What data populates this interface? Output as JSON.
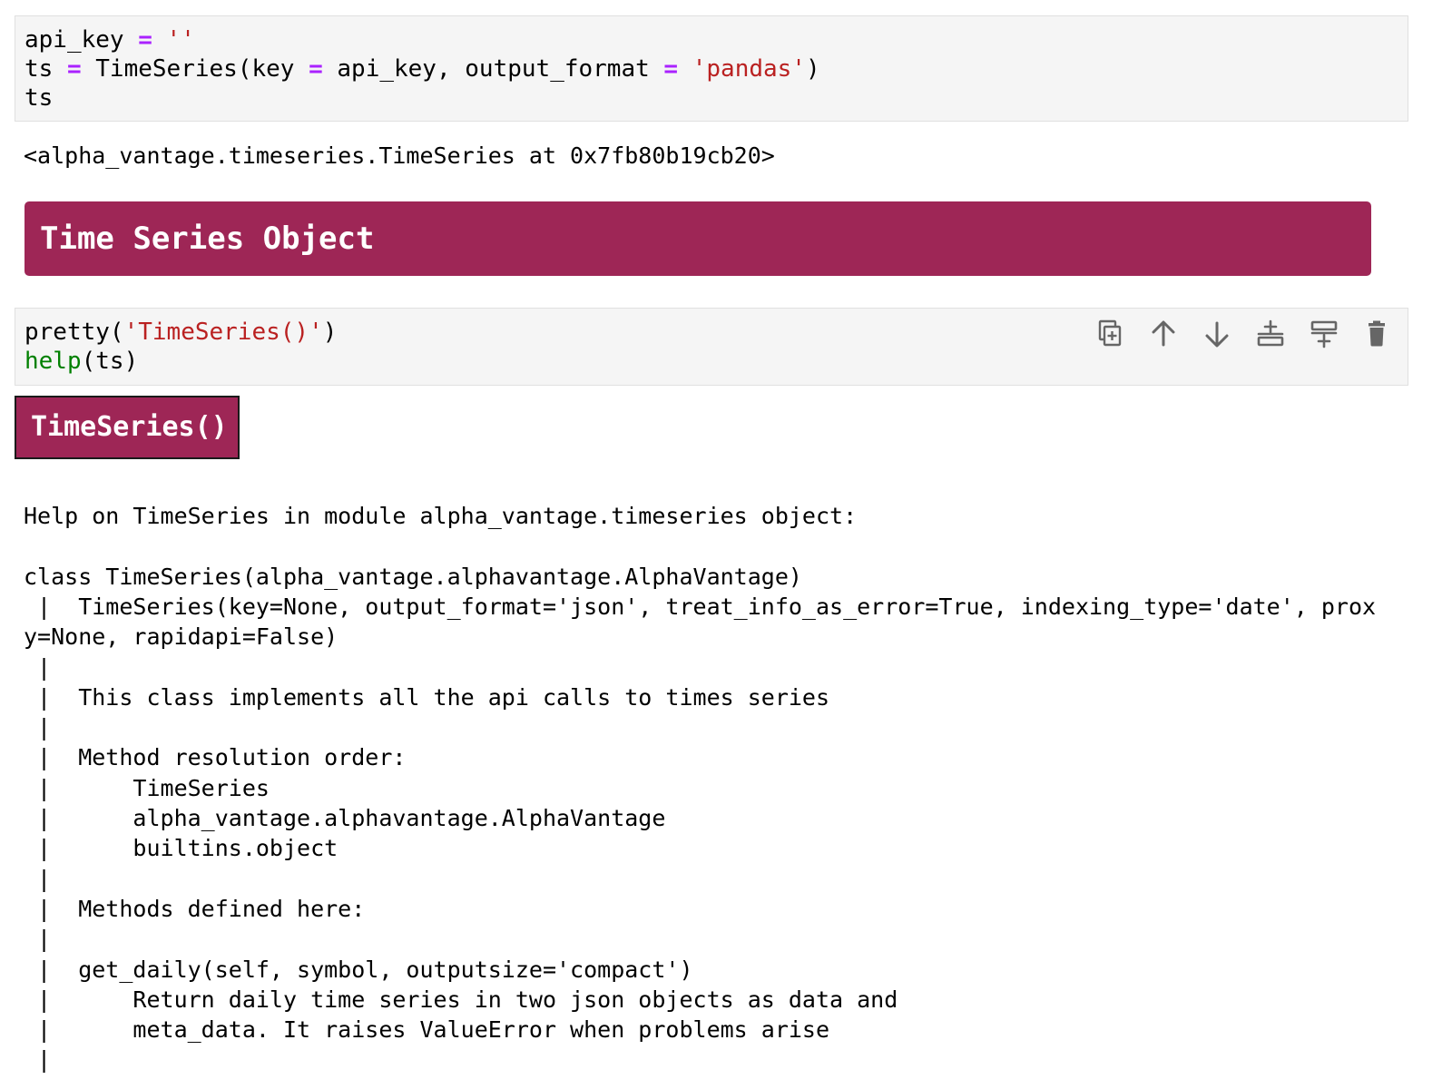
{
  "cell1": {
    "lines": [
      [
        {
          "t": "api_key "
        },
        {
          "t": "=",
          "c": "op"
        },
        {
          "t": " "
        },
        {
          "t": "''",
          "c": "str"
        }
      ],
      [
        {
          "t": "ts "
        },
        {
          "t": "=",
          "c": "op"
        },
        {
          "t": " TimeSeries(key "
        },
        {
          "t": "=",
          "c": "op"
        },
        {
          "t": " api_key, output_format "
        },
        {
          "t": "=",
          "c": "op"
        },
        {
          "t": " "
        },
        {
          "t": "'pandas'",
          "c": "str"
        },
        {
          "t": ")"
        }
      ],
      [
        {
          "t": "ts"
        }
      ]
    ],
    "output": "<alpha_vantage.timeseries.TimeSeries at 0x7fb80b19cb20>"
  },
  "banner_title": "Time Series Object",
  "cell2": {
    "lines": [
      [
        {
          "t": "pretty("
        },
        {
          "t": "'TimeSeries()'",
          "c": "str"
        },
        {
          "t": ")"
        }
      ],
      [
        {
          "t": "help",
          "c": "builtin"
        },
        {
          "t": "(ts)"
        }
      ]
    ]
  },
  "toolbar": {
    "icons": [
      "duplicate-cell-icon",
      "move-up-icon",
      "move-down-icon",
      "insert-cell-above-icon",
      "insert-cell-below-icon",
      "delete-cell-icon"
    ]
  },
  "output_banner_title": "TimeSeries()",
  "help_text": {
    "lines": [
      "Help on TimeSeries in module alpha_vantage.timeseries object:",
      "",
      "class TimeSeries(alpha_vantage.alphavantage.AlphaVantage)",
      " |  TimeSeries(key=None, output_format='json', treat_info_as_error=True, indexing_type='date', prox",
      "y=None, rapidapi=False)",
      " |",
      " |  This class implements all the api calls to times series",
      " |",
      " |  Method resolution order:",
      " |      TimeSeries",
      " |      alpha_vantage.alphavantage.AlphaVantage",
      " |      builtins.object",
      " |",
      " |  Methods defined here:",
      " |",
      " |  get_daily(self, symbol, outputsize='compact')",
      " |      Return daily time series in two json objects as data and",
      " |      meta_data. It raises ValueError when problems arise",
      " |"
    ]
  }
}
